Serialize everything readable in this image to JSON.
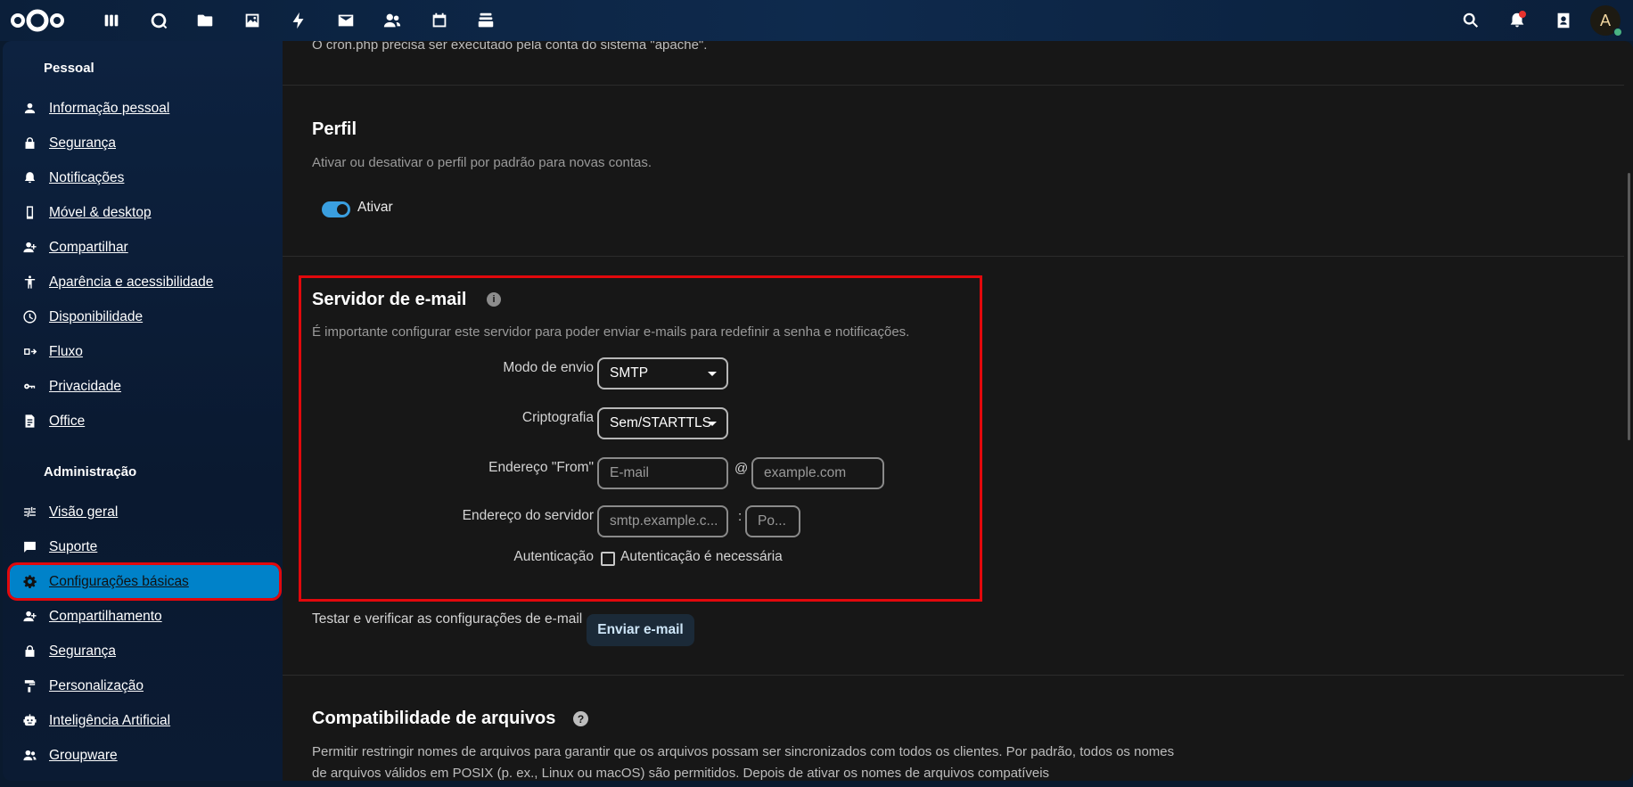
{
  "header": {
    "apps": [
      {
        "name": "dashboard-icon"
      },
      {
        "name": "search-app-icon"
      },
      {
        "name": "files-icon"
      },
      {
        "name": "photos-icon"
      },
      {
        "name": "activity-icon"
      },
      {
        "name": "mail-icon"
      },
      {
        "name": "contacts-icon"
      },
      {
        "name": "calendar-icon"
      },
      {
        "name": "deck-icon"
      }
    ],
    "avatar_letter": "A"
  },
  "sidebar": {
    "personal_title": "Pessoal",
    "personal_items": [
      {
        "label": "Informação pessoal",
        "icon": "person-icon"
      },
      {
        "label": "Segurança",
        "icon": "lock-icon"
      },
      {
        "label": "Notificações",
        "icon": "bell-icon"
      },
      {
        "label": "Móvel & desktop",
        "icon": "phone-icon"
      },
      {
        "label": "Compartilhar",
        "icon": "share-person-icon"
      },
      {
        "label": "Aparência e acessibilidade",
        "icon": "accessibility-icon"
      },
      {
        "label": "Disponibilidade",
        "icon": "clock-icon"
      },
      {
        "label": "Fluxo",
        "icon": "flow-icon"
      },
      {
        "label": "Privacidade",
        "icon": "key-icon"
      },
      {
        "label": "Office",
        "icon": "document-icon"
      }
    ],
    "admin_title": "Administração",
    "admin_items": [
      {
        "label": "Visão geral",
        "icon": "tune-icon"
      },
      {
        "label": "Suporte",
        "icon": "chat-icon"
      },
      {
        "label": "Configurações básicas",
        "icon": "gear-icon",
        "active": true
      },
      {
        "label": "Compartilhamento",
        "icon": "share-person-icon"
      },
      {
        "label": "Segurança",
        "icon": "lock-icon"
      },
      {
        "label": "Personalização",
        "icon": "paint-roller-icon"
      },
      {
        "label": "Inteligência Artificial",
        "icon": "robot-icon"
      },
      {
        "label": "Groupware",
        "icon": "group-icon"
      }
    ]
  },
  "main": {
    "cron_text": "O cron.php precisa ser executado pela conta do sistema \"apache\".",
    "profile": {
      "title": "Perfil",
      "description": "Ativar ou desativar o perfil por padrão para novas contas.",
      "toggle_label": "Ativar",
      "enabled": true
    },
    "mail_server": {
      "title": "Servidor de e-mail",
      "description": "É importante configurar este servidor para poder enviar e-mails para redefinir a senha e notificações.",
      "send_mode_label": "Modo de envio",
      "send_mode_value": "SMTP",
      "encryption_label": "Criptografia",
      "encryption_value": "Sem/STARTTLS",
      "from_label": "Endereço \"From\"",
      "from_placeholder": "E-mail",
      "at_sign": "@",
      "domain_placeholder": "example.com",
      "server_label": "Endereço do servidor",
      "server_placeholder": "smtp.example.c...",
      "colon": ":",
      "port_placeholder": "Po...",
      "auth_label": "Autenticação",
      "auth_checkbox_label": "Autenticação é necessária",
      "auth_checked": false,
      "test_label": "Testar e verificar as configurações de e-mail",
      "send_button": "Enviar e-mail"
    },
    "file_compat": {
      "title": "Compatibilidade de arquivos",
      "description": "Permitir restringir nomes de arquivos para garantir que os arquivos possam ser sincronizados com todos os clientes. Por padrão, todos os nomes de arquivos válidos em POSIX (p. ex., Linux ou macOS) são permitidos. Depois de ativar os nomes de arquivos compatíveis"
    }
  },
  "colors": {
    "accent": "#0082c9",
    "highlight_border": "#e2080c",
    "background": "#171717"
  }
}
